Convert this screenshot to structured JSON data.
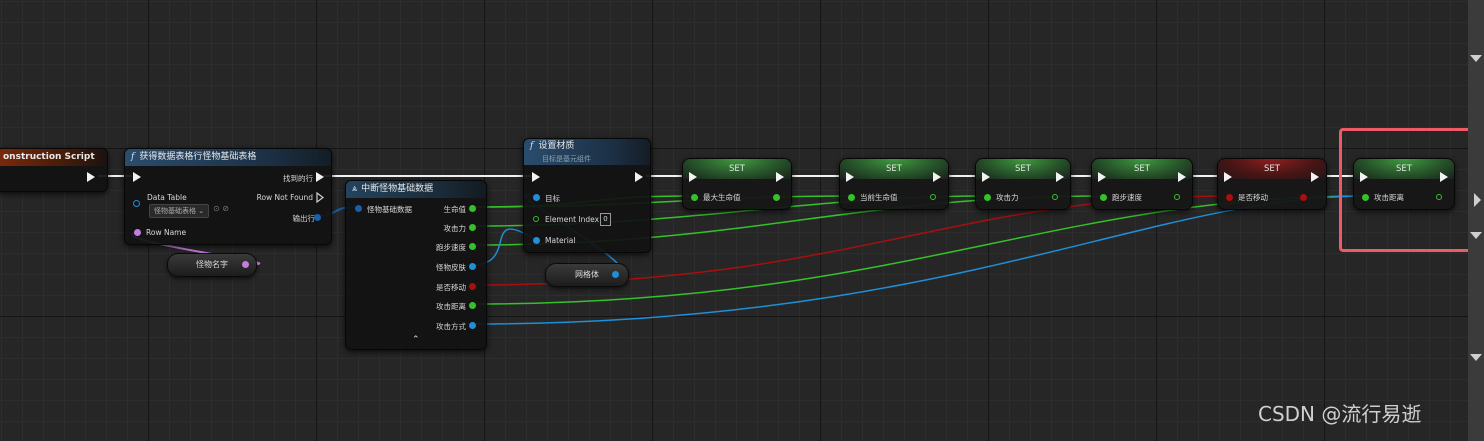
{
  "construction_script": {
    "title": "onstruction Script"
  },
  "get_row_node": {
    "title": "获得数据表格行怪物基础表格",
    "data_table_label": "Data Table",
    "data_table_value": "怪物基础表格",
    "row_name_label": "Row Name",
    "found_label": "找到的行",
    "not_found_label": "Row Not Found",
    "out_row_label": "输出行"
  },
  "row_name_var": {
    "label": "怪物名字"
  },
  "break_node": {
    "title": "中断怪物基础数据",
    "input_label": "怪物基础数据",
    "outputs": [
      "生命值",
      "攻击力",
      "跑步速度",
      "怪物皮肤",
      "是否移动",
      "攻击距离",
      "攻击方式"
    ]
  },
  "set_material_node": {
    "title": "设置材质",
    "subtitle": "目标是基元组件",
    "target_label": "目标",
    "element_index_label": "Element Index",
    "element_index_value": "0",
    "material_label": "Material"
  },
  "mesh_var": {
    "label": "网格体"
  },
  "set_nodes": [
    {
      "header": "SET",
      "variable": "最大生命值",
      "style": "green"
    },
    {
      "header": "SET",
      "variable": "当前生命值",
      "style": "green"
    },
    {
      "header": "SET",
      "variable": "攻击力",
      "style": "green"
    },
    {
      "header": "SET",
      "variable": "跑步速度",
      "style": "green"
    },
    {
      "header": "SET",
      "variable": "是否移动",
      "style": "red"
    },
    {
      "header": "SET",
      "variable": "攻击距离",
      "style": "green"
    }
  ],
  "watermark": "CSDN @流行易逝",
  "colors": {
    "exec": "#f2f2f2",
    "float_pin": "#35c12a",
    "object_pin": "#1e8fd8",
    "bool_pin": "#a80f0f",
    "name_pin": "#c57be0",
    "struct_pin": "#1a5fa8",
    "highlight": "#ee5a66"
  }
}
